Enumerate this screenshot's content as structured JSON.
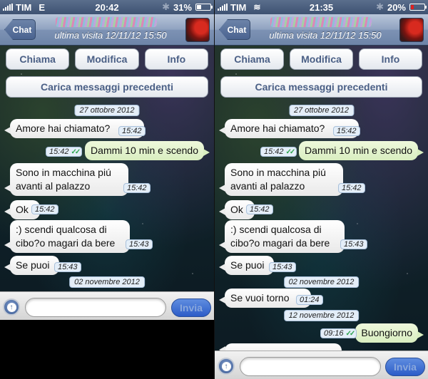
{
  "screens": [
    {
      "status": {
        "carrier": "TIM",
        "network": "E",
        "time": "20:42",
        "battery": "31%",
        "battery_level": 0.31,
        "battery_color": "#ffffff"
      },
      "header": {
        "back_label": "Chat",
        "contact_subtitle": "ultima visita 12/11/12 15:50"
      },
      "actions": {
        "call": "Chiama",
        "edit": "Modifica",
        "info": "Info",
        "load_previous": "Carica messaggi precedenti"
      },
      "messages": [
        {
          "type": "date",
          "text": "27 ottobre 2012"
        },
        {
          "type": "in",
          "text": "Amore hai chiamato?",
          "time": "15:42"
        },
        {
          "type": "out",
          "text": "Dammi 10 min e scendo",
          "time": "15:42",
          "read": true
        },
        {
          "type": "in",
          "text": "Sono in macchina piú avanti al palazzo",
          "time": "15:42"
        },
        {
          "type": "in",
          "text": "Ok",
          "time": "15:42"
        },
        {
          "type": "in",
          "text": ":) scendi qualcosa di cibo?o magari da bere",
          "time": "15:43"
        },
        {
          "type": "in",
          "text": "Se puoi",
          "time": "15:43"
        },
        {
          "type": "date",
          "text": "02 novembre 2012"
        }
      ],
      "input": {
        "placeholder": "",
        "send_label": "Invia"
      }
    },
    {
      "status": {
        "carrier": "TIM",
        "network": "wifi",
        "time": "21:35",
        "battery": "20%",
        "battery_level": 0.2,
        "battery_color": "#e02020"
      },
      "header": {
        "back_label": "Chat",
        "contact_subtitle": "ultima visita 12/11/12 15:50"
      },
      "actions": {
        "call": "Chiama",
        "edit": "Modifica",
        "info": "Info",
        "load_previous": "Carica messaggi precedenti"
      },
      "messages": [
        {
          "type": "date",
          "text": "27 ottobre 2012"
        },
        {
          "type": "in",
          "text": "Amore hai chiamato?",
          "time": "15:42"
        },
        {
          "type": "out",
          "text": "Dammi 10 min e scendo",
          "time": "15:42",
          "read": true
        },
        {
          "type": "in",
          "text": "Sono in macchina piú avanti al palazzo",
          "time": "15:42"
        },
        {
          "type": "in",
          "text": "Ok",
          "time": "15:42"
        },
        {
          "type": "in",
          "text": ":) scendi qualcosa di cibo?o magari da bere",
          "time": "15:43"
        },
        {
          "type": "in",
          "text": "Se puoi",
          "time": "15:43"
        },
        {
          "type": "date",
          "text": "02 novembre 2012"
        },
        {
          "type": "in",
          "text": "Se vuoi torno",
          "time": "01:24"
        },
        {
          "type": "date",
          "text": "12 novembre 2012"
        },
        {
          "type": "out",
          "text": "Buongiorno",
          "time": "09:16",
          "read": true
        }
      ],
      "input": {
        "placeholder": "",
        "send_label": "Invia"
      }
    }
  ]
}
